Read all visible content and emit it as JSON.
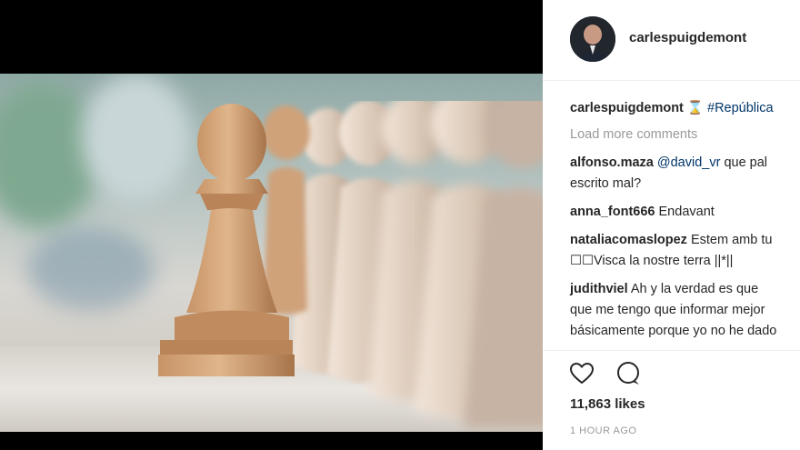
{
  "post": {
    "author": "carlespuigdemont",
    "likes": "11,863 likes",
    "time": "1 HOUR AGO"
  },
  "caption": {
    "user": "carlespuigdemont",
    "hourglass": "⌛",
    "tag": "#República"
  },
  "load_more": "Load more comments",
  "comments": [
    {
      "user": "alfonso.maza",
      "mention": "@david_vr",
      "line1": " que pal",
      "line2": "escrito mal?"
    },
    {
      "user": "anna_font666",
      "line1": " Endavant"
    },
    {
      "user": "nataliacomaslopez",
      "line1": " Estem amb tu",
      "line2": "☐☐Visca la nostre terra ||*||"
    },
    {
      "user": "judithviel",
      "line1": " Ah y la verdad es que",
      "line2": "que me tengo que informar mejor",
      "line3": "básicamente porque yo no he dado"
    }
  ],
  "icons": {
    "like": "heart-icon",
    "comment": "comment-bubble-icon"
  }
}
